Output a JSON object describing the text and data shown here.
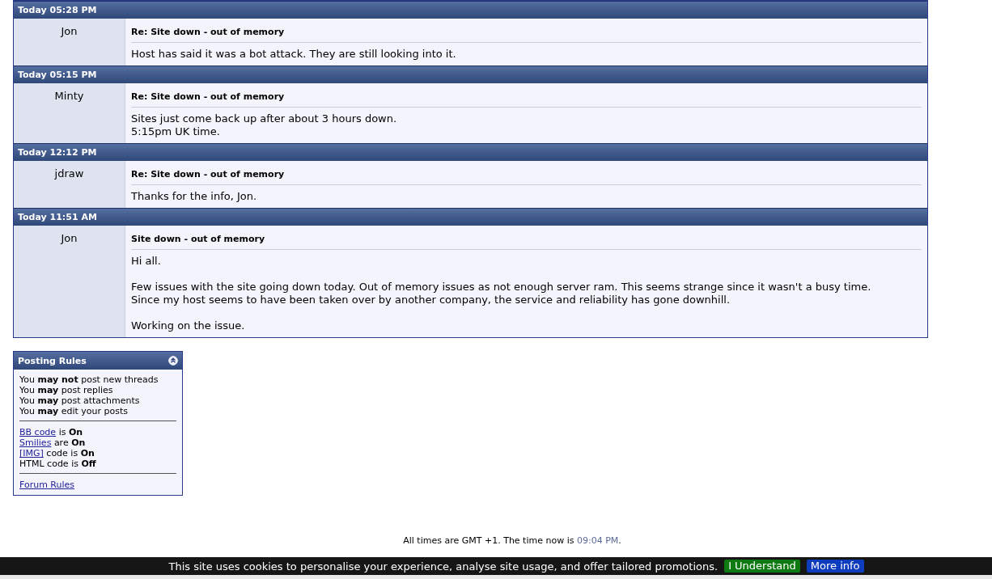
{
  "posts": [
    {
      "date": "Today 05:28 PM",
      "author": "Jon",
      "title": "Re: Site down - out of memory",
      "paragraphs": [
        [
          "Host has said it was a bot attack. They are still looking into it."
        ]
      ]
    },
    {
      "date": "Today 05:15 PM",
      "author": "Minty",
      "title": "Re: Site down - out of memory",
      "paragraphs": [
        [
          "Sites just come back up after about 3 hours down.",
          "5:15pm UK time."
        ]
      ]
    },
    {
      "date": "Today 12:12 PM",
      "author": "jdraw",
      "title": "Re: Site down - out of memory",
      "paragraphs": [
        [
          "Thanks for the info, Jon."
        ]
      ]
    },
    {
      "date": "Today 11:51 AM",
      "author": "Jon",
      "title": "Site down - out of memory",
      "paragraphs": [
        [
          "Hi all."
        ],
        [
          "Few issues with the site going down today. Out of memory issues as not enough server ram. This seems strange since it wasn't a busy time.",
          "Since my host seems to have been taken over by another company, the service and reliability has gone downhill."
        ],
        [
          "Working on the issue."
        ]
      ]
    }
  ],
  "posting_rules": {
    "title": "Posting Rules",
    "permissions": [
      "You **may not** post new threads",
      "You **may** post replies",
      "You **may** post attachments",
      "You **may** edit your posts"
    ],
    "settings": [
      {
        "link": "BB code",
        "text": "is **On**"
      },
      {
        "link": "Smilies",
        "text": "are **On**"
      },
      {
        "link": "[IMG]",
        "text": "code is **On**"
      },
      {
        "text": "HTML code is **Off**"
      }
    ],
    "forum_rules_link": "Forum Rules"
  },
  "footer": {
    "text": "All times are GMT +1. The time now is ",
    "time": "09:04 PM",
    "end": "."
  },
  "cookie_bar": {
    "message": "This site uses cookies to personalise your experience, analyse site usage, and offer tailored promotions.",
    "accept_button": "I Understand",
    "more_button": "More info"
  }
}
